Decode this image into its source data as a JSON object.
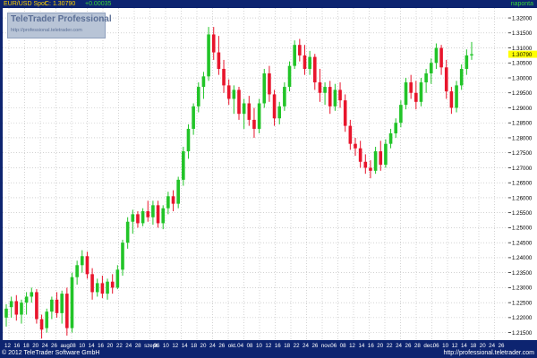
{
  "header": {
    "instrument": "EUR/USD Spot",
    "close_label": "C: 1.30790",
    "change": "+0.00035",
    "period": "naponta"
  },
  "watermark": {
    "title": "TeleTrader Professional",
    "url": "http://professional.teletrader.com"
  },
  "footer": {
    "copyright": "© 2012 TeleTrader Software GmbH",
    "url": "http://professional.teletrader.com"
  },
  "colors": {
    "up": "#22c428",
    "down": "#e8152c",
    "frame": "#0d2470",
    "grid": "#b8b8b8",
    "header_text": "#ffd200",
    "change_text": "#38d438",
    "price_marker": "#ffff00"
  },
  "chart_data": {
    "type": "candlestick",
    "ylim": [
      1.2125,
      1.3233
    ],
    "ytick_values": [
      1.215,
      1.22,
      1.225,
      1.23,
      1.235,
      1.24,
      1.245,
      1.25,
      1.255,
      1.26,
      1.265,
      1.27,
      1.275,
      1.28,
      1.285,
      1.29,
      1.295,
      1.3,
      1.305,
      1.31,
      1.315,
      1.32
    ],
    "ytick_labels": [
      "1.21500",
      "1.22000",
      "1.22500",
      "1.23000",
      "1.23500",
      "1.24000",
      "1.24500",
      "1.25000",
      "1.25500",
      "1.26000",
      "1.26500",
      "1.27000",
      "1.27500",
      "1.28000",
      "1.28500",
      "1.29000",
      "1.29500",
      "1.30000",
      "1.30500",
      "1.31000",
      "1.31500",
      "1.32000"
    ],
    "last_price_label": "1.30790",
    "last_price": 1.3079,
    "x_tick_labels": [
      "12",
      "16",
      "18",
      "20",
      "24",
      "26",
      "aug.",
      "08",
      "10",
      "14",
      "16",
      "20",
      "22",
      "24",
      "28",
      "szept.",
      "06",
      "10",
      "12",
      "14",
      "18",
      "20",
      "24",
      "26",
      "okt.",
      "04",
      "08",
      "10",
      "12",
      "16",
      "18",
      "22",
      "24",
      "26",
      "nov.",
      "06",
      "08",
      "12",
      "14",
      "16",
      "20",
      "22",
      "24",
      "26",
      "28",
      "dec.",
      "06",
      "10",
      "12",
      "14",
      "18",
      "20",
      "24",
      "26"
    ],
    "candles": [
      {
        "o": 1.22,
        "h": 1.2245,
        "l": 1.217,
        "c": 1.223
      },
      {
        "o": 1.2235,
        "h": 1.227,
        "l": 1.22,
        "c": 1.2255
      },
      {
        "o": 1.2255,
        "h": 1.2275,
        "l": 1.219,
        "c": 1.221
      },
      {
        "o": 1.221,
        "h": 1.226,
        "l": 1.218,
        "c": 1.225
      },
      {
        "o": 1.225,
        "h": 1.2285,
        "l": 1.221,
        "c": 1.227
      },
      {
        "o": 1.227,
        "h": 1.23,
        "l": 1.225,
        "c": 1.2285
      },
      {
        "o": 1.2285,
        "h": 1.2295,
        "l": 1.218,
        "c": 1.2195
      },
      {
        "o": 1.2195,
        "h": 1.221,
        "l": 1.213,
        "c": 1.216
      },
      {
        "o": 1.2165,
        "h": 1.223,
        "l": 1.215,
        "c": 1.222
      },
      {
        "o": 1.222,
        "h": 1.227,
        "l": 1.2195,
        "c": 1.226
      },
      {
        "o": 1.226,
        "h": 1.2285,
        "l": 1.22,
        "c": 1.2215
      },
      {
        "o": 1.2215,
        "h": 1.229,
        "l": 1.218,
        "c": 1.228
      },
      {
        "o": 1.228,
        "h": 1.23,
        "l": 1.214,
        "c": 1.2165
      },
      {
        "o": 1.2165,
        "h": 1.235,
        "l": 1.215,
        "c": 1.2335
      },
      {
        "o": 1.2335,
        "h": 1.239,
        "l": 1.231,
        "c": 1.2375
      },
      {
        "o": 1.2375,
        "h": 1.2425,
        "l": 1.235,
        "c": 1.2405
      },
      {
        "o": 1.2405,
        "h": 1.242,
        "l": 1.233,
        "c": 1.2345
      },
      {
        "o": 1.2345,
        "h": 1.2365,
        "l": 1.226,
        "c": 1.2285
      },
      {
        "o": 1.2285,
        "h": 1.233,
        "l": 1.227,
        "c": 1.2315
      },
      {
        "o": 1.2315,
        "h": 1.234,
        "l": 1.2265,
        "c": 1.228
      },
      {
        "o": 1.228,
        "h": 1.233,
        "l": 1.226,
        "c": 1.232
      },
      {
        "o": 1.232,
        "h": 1.2345,
        "l": 1.228,
        "c": 1.23
      },
      {
        "o": 1.23,
        "h": 1.2375,
        "l": 1.2295,
        "c": 1.236
      },
      {
        "o": 1.236,
        "h": 1.246,
        "l": 1.234,
        "c": 1.245
      },
      {
        "o": 1.245,
        "h": 1.2535,
        "l": 1.243,
        "c": 1.252
      },
      {
        "o": 1.252,
        "h": 1.256,
        "l": 1.248,
        "c": 1.2545
      },
      {
        "o": 1.2545,
        "h": 1.2555,
        "l": 1.25,
        "c": 1.2515
      },
      {
        "o": 1.2515,
        "h": 1.2565,
        "l": 1.2505,
        "c": 1.2555
      },
      {
        "o": 1.2555,
        "h": 1.259,
        "l": 1.252,
        "c": 1.2535
      },
      {
        "o": 1.2535,
        "h": 1.259,
        "l": 1.251,
        "c": 1.2575
      },
      {
        "o": 1.2575,
        "h": 1.259,
        "l": 1.25,
        "c": 1.2515
      },
      {
        "o": 1.2515,
        "h": 1.2575,
        "l": 1.2495,
        "c": 1.2565
      },
      {
        "o": 1.2565,
        "h": 1.262,
        "l": 1.2545,
        "c": 1.2605
      },
      {
        "o": 1.2605,
        "h": 1.2625,
        "l": 1.2555,
        "c": 1.258
      },
      {
        "o": 1.258,
        "h": 1.267,
        "l": 1.2565,
        "c": 1.266
      },
      {
        "o": 1.266,
        "h": 1.277,
        "l": 1.264,
        "c": 1.2755
      },
      {
        "o": 1.2755,
        "h": 1.2845,
        "l": 1.273,
        "c": 1.283
      },
      {
        "o": 1.283,
        "h": 1.2915,
        "l": 1.281,
        "c": 1.2905
      },
      {
        "o": 1.2905,
        "h": 1.2985,
        "l": 1.2885,
        "c": 1.297
      },
      {
        "o": 1.297,
        "h": 1.302,
        "l": 1.293,
        "c": 1.3005
      },
      {
        "o": 1.3005,
        "h": 1.317,
        "l": 1.299,
        "c": 1.3145
      },
      {
        "o": 1.3145,
        "h": 1.317,
        "l": 1.306,
        "c": 1.3085
      },
      {
        "o": 1.3085,
        "h": 1.314,
        "l": 1.301,
        "c": 1.303
      },
      {
        "o": 1.303,
        "h": 1.306,
        "l": 1.295,
        "c": 1.2975
      },
      {
        "o": 1.2975,
        "h": 1.2995,
        "l": 1.291,
        "c": 1.293
      },
      {
        "o": 1.293,
        "h": 1.2975,
        "l": 1.288,
        "c": 1.296
      },
      {
        "o": 1.296,
        "h": 1.297,
        "l": 1.286,
        "c": 1.288
      },
      {
        "o": 1.288,
        "h": 1.293,
        "l": 1.283,
        "c": 1.2915
      },
      {
        "o": 1.2915,
        "h": 1.294,
        "l": 1.284,
        "c": 1.286
      },
      {
        "o": 1.286,
        "h": 1.29,
        "l": 1.28,
        "c": 1.283
      },
      {
        "o": 1.283,
        "h": 1.293,
        "l": 1.2815,
        "c": 1.2915
      },
      {
        "o": 1.2915,
        "h": 1.303,
        "l": 1.29,
        "c": 1.3015
      },
      {
        "o": 1.3015,
        "h": 1.304,
        "l": 1.292,
        "c": 1.2945
      },
      {
        "o": 1.2945,
        "h": 1.296,
        "l": 1.284,
        "c": 1.2865
      },
      {
        "o": 1.2865,
        "h": 1.292,
        "l": 1.2845,
        "c": 1.2905
      },
      {
        "o": 1.2905,
        "h": 1.2985,
        "l": 1.289,
        "c": 1.297
      },
      {
        "o": 1.297,
        "h": 1.3055,
        "l": 1.2955,
        "c": 1.304
      },
      {
        "o": 1.304,
        "h": 1.3125,
        "l": 1.303,
        "c": 1.311
      },
      {
        "o": 1.311,
        "h": 1.313,
        "l": 1.3055,
        "c": 1.3075
      },
      {
        "o": 1.3075,
        "h": 1.311,
        "l": 1.301,
        "c": 1.303
      },
      {
        "o": 1.303,
        "h": 1.309,
        "l": 1.301,
        "c": 1.307
      },
      {
        "o": 1.307,
        "h": 1.308,
        "l": 1.296,
        "c": 1.2985
      },
      {
        "o": 1.2985,
        "h": 1.303,
        "l": 1.292,
        "c": 1.295
      },
      {
        "o": 1.295,
        "h": 1.2985,
        "l": 1.291,
        "c": 1.297
      },
      {
        "o": 1.297,
        "h": 1.299,
        "l": 1.288,
        "c": 1.2905
      },
      {
        "o": 1.2905,
        "h": 1.298,
        "l": 1.289,
        "c": 1.296
      },
      {
        "o": 1.296,
        "h": 1.2985,
        "l": 1.29,
        "c": 1.2925
      },
      {
        "o": 1.2925,
        "h": 1.2945,
        "l": 1.282,
        "c": 1.284
      },
      {
        "o": 1.284,
        "h": 1.286,
        "l": 1.276,
        "c": 1.278
      },
      {
        "o": 1.278,
        "h": 1.28,
        "l": 1.274,
        "c": 1.2765
      },
      {
        "o": 1.2765,
        "h": 1.279,
        "l": 1.27,
        "c": 1.272
      },
      {
        "o": 1.272,
        "h": 1.2745,
        "l": 1.268,
        "c": 1.27
      },
      {
        "o": 1.27,
        "h": 1.2725,
        "l": 1.2665,
        "c": 1.269
      },
      {
        "o": 1.269,
        "h": 1.277,
        "l": 1.268,
        "c": 1.2755
      },
      {
        "o": 1.2755,
        "h": 1.279,
        "l": 1.269,
        "c": 1.271
      },
      {
        "o": 1.271,
        "h": 1.2795,
        "l": 1.27,
        "c": 1.278
      },
      {
        "o": 1.278,
        "h": 1.283,
        "l": 1.2765,
        "c": 1.2815
      },
      {
        "o": 1.2815,
        "h": 1.2865,
        "l": 1.28,
        "c": 1.285
      },
      {
        "o": 1.285,
        "h": 1.2925,
        "l": 1.2835,
        "c": 1.291
      },
      {
        "o": 1.291,
        "h": 1.3,
        "l": 1.2895,
        "c": 1.2985
      },
      {
        "o": 1.2985,
        "h": 1.301,
        "l": 1.293,
        "c": 1.295
      },
      {
        "o": 1.295,
        "h": 1.299,
        "l": 1.2895,
        "c": 1.292
      },
      {
        "o": 1.292,
        "h": 1.3,
        "l": 1.2905,
        "c": 1.2985
      },
      {
        "o": 1.2985,
        "h": 1.303,
        "l": 1.295,
        "c": 1.3015
      },
      {
        "o": 1.3015,
        "h": 1.3065,
        "l": 1.298,
        "c": 1.305
      },
      {
        "o": 1.305,
        "h": 1.3115,
        "l": 1.303,
        "c": 1.31
      },
      {
        "o": 1.31,
        "h": 1.311,
        "l": 1.301,
        "c": 1.3035
      },
      {
        "o": 1.3035,
        "h": 1.306,
        "l": 1.293,
        "c": 1.2955
      },
      {
        "o": 1.2955,
        "h": 1.297,
        "l": 1.288,
        "c": 1.29
      },
      {
        "o": 1.29,
        "h": 1.299,
        "l": 1.2885,
        "c": 1.2975
      },
      {
        "o": 1.2975,
        "h": 1.3045,
        "l": 1.296,
        "c": 1.303
      },
      {
        "o": 1.303,
        "h": 1.3095,
        "l": 1.301,
        "c": 1.3075
      },
      {
        "o": 1.3075,
        "h": 1.312,
        "l": 1.306,
        "c": 1.3079
      }
    ]
  }
}
